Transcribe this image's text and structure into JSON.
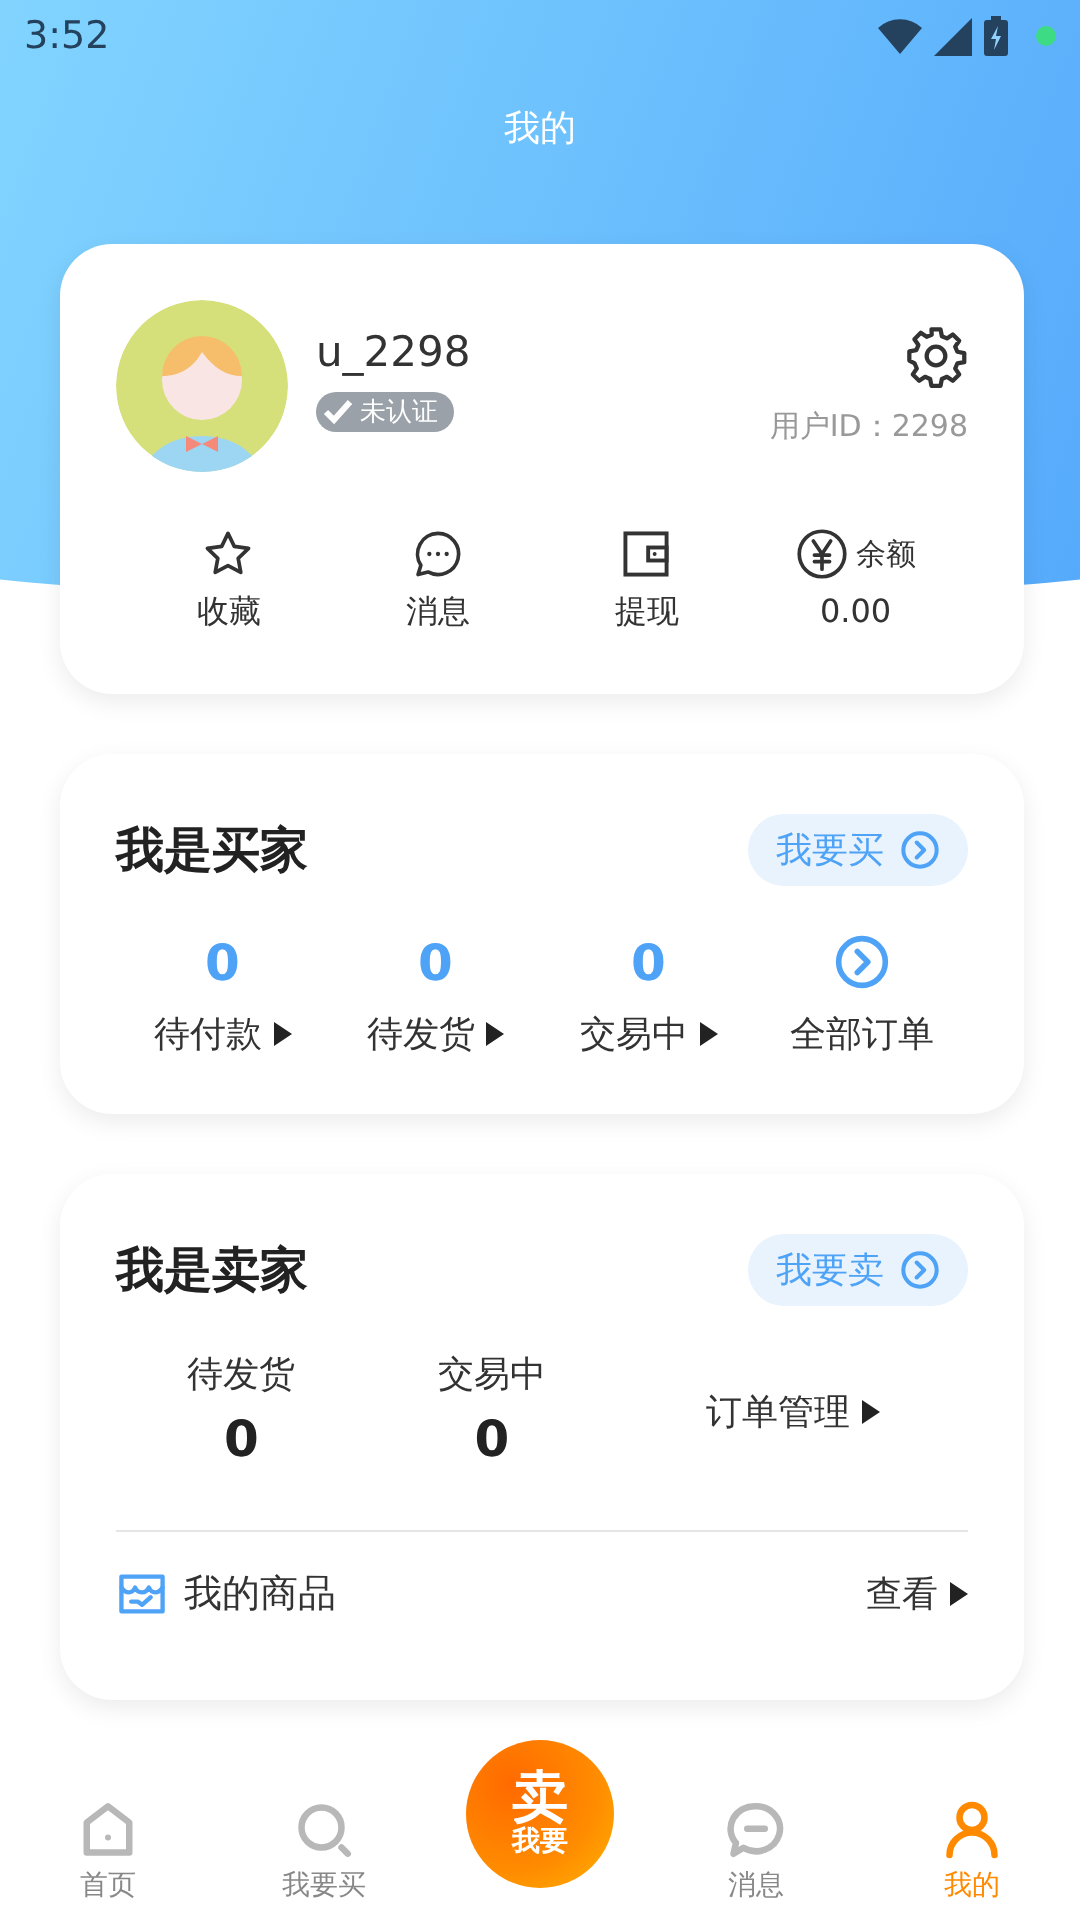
{
  "status_bar": {
    "time": "3:52"
  },
  "title": "我的",
  "profile": {
    "username": "u_2298",
    "badge": {
      "label": "未认证",
      "verified": false
    },
    "user_id": "用户ID：2298",
    "actions": [
      {
        "kind": "star",
        "label": "收藏"
      },
      {
        "kind": "message",
        "label": "消息"
      },
      {
        "kind": "wallet",
        "label": "提现"
      }
    ],
    "balance": {
      "label": "余额",
      "value": "0.00"
    }
  },
  "buyer": {
    "title": "我是买家",
    "button": "我要买",
    "stats": [
      {
        "count": "0",
        "label": "待付款"
      },
      {
        "count": "0",
        "label": "待发货"
      },
      {
        "count": "0",
        "label": "交易中"
      }
    ],
    "all_orders": "全部订单"
  },
  "seller": {
    "title": "我是卖家",
    "button": "我要卖",
    "stats": [
      {
        "label": "待发货",
        "count": "0"
      },
      {
        "label": "交易中",
        "count": "0"
      }
    ],
    "manage": "订单管理",
    "goods": {
      "label": "我的商品",
      "action": "查看"
    }
  },
  "tab_bar": [
    {
      "kind": "home",
      "label": "首页",
      "selected": false
    },
    {
      "kind": "search",
      "label": "我要买",
      "selected": false
    },
    {
      "kind": "sell",
      "big": "卖",
      "small": "我要"
    },
    {
      "kind": "message",
      "label": "消息",
      "selected": false
    },
    {
      "kind": "profile",
      "label": "我的",
      "selected": true
    }
  ]
}
